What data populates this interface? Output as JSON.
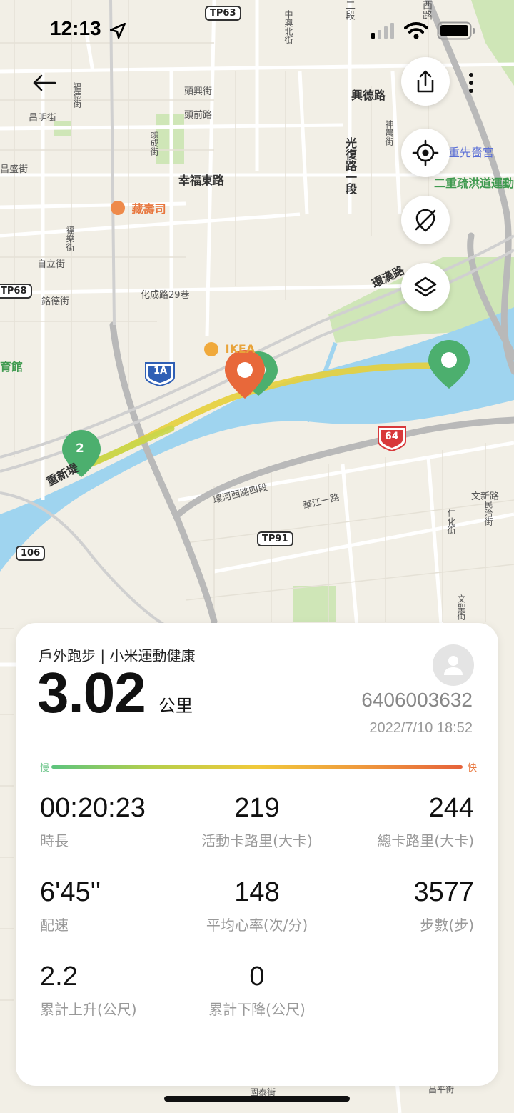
{
  "status_bar": {
    "time": "12:13"
  },
  "map": {
    "labels": [
      {
        "text": "TP63",
        "type": "badge"
      },
      {
        "text": "中興北街"
      },
      {
        "text": "二段"
      },
      {
        "text": "西路"
      },
      {
        "text": "福德街"
      },
      {
        "text": "頭興街"
      },
      {
        "text": "頭前路"
      },
      {
        "text": "昌明街"
      },
      {
        "text": "興德路"
      },
      {
        "text": "神農街"
      },
      {
        "text": "光復路一段"
      },
      {
        "text": "重先嗇宮"
      },
      {
        "text": "頭成街"
      },
      {
        "text": "昌盛街"
      },
      {
        "text": "幸福東路"
      },
      {
        "text": "二重疏洪道運動"
      },
      {
        "text": "藏壽司"
      },
      {
        "text": "福樂街"
      },
      {
        "text": "自立街"
      },
      {
        "text": "化成路29巷"
      },
      {
        "text": "環漢路"
      },
      {
        "text": "TP68",
        "type": "badge"
      },
      {
        "text": "銘德街"
      },
      {
        "text": "育館"
      },
      {
        "text": "IKEA"
      },
      {
        "text": "1A",
        "type": "shield"
      },
      {
        "text": "64",
        "type": "shield"
      },
      {
        "text": "重新堤"
      },
      {
        "text": "環河西路四段"
      },
      {
        "text": "華江一路"
      },
      {
        "text": "文新路"
      },
      {
        "text": "仁化街"
      },
      {
        "text": "民治街"
      },
      {
        "text": "TP91",
        "type": "badge"
      },
      {
        "text": "106",
        "type": "badge"
      },
      {
        "text": "文聖街"
      },
      {
        "text": "國泰街"
      },
      {
        "text": "昌平街"
      }
    ],
    "markers": [
      {
        "label": "2",
        "color": "#4caf6e"
      },
      {
        "label": "",
        "color": "#e8683a"
      },
      {
        "label": "",
        "color": "#4caf6e"
      },
      {
        "label": "",
        "color": "#4caf6e"
      }
    ]
  },
  "buttons": {
    "back_icon": "arrow-left-icon",
    "share_icon": "share-icon",
    "more_icon": "more-vertical-icon",
    "locate_icon": "target-icon",
    "hide_icon": "visibility-off-icon",
    "layers_icon": "layers-icon"
  },
  "summary": {
    "subtitle": "戶外跑步 | 小米運動健康",
    "distance": "3.02",
    "distance_unit": "公里",
    "user_id": "6406003632",
    "date": "2022/7/10 18:52",
    "speed_slow_label": "慢",
    "speed_fast_label": "快",
    "stats": [
      {
        "value": "00:20:23",
        "label": "時長"
      },
      {
        "value": "219",
        "label": "活動卡路里(大卡)"
      },
      {
        "value": "244",
        "label": "總卡路里(大卡)"
      },
      {
        "value": "6'45''",
        "label": "配速"
      },
      {
        "value": "148",
        "label": "平均心率(次/分)"
      },
      {
        "value": "3577",
        "label": "步數(步)"
      },
      {
        "value": "2.2",
        "label": "累計上升(公尺)"
      },
      {
        "value": "0",
        "label": "累計下降(公尺)"
      }
    ]
  },
  "colors": {
    "river": "#9fd4ef",
    "park": "#cfe6b7",
    "marker_green": "#4caf6e",
    "marker_orange": "#e8683a",
    "route": "#e6cf3a"
  }
}
